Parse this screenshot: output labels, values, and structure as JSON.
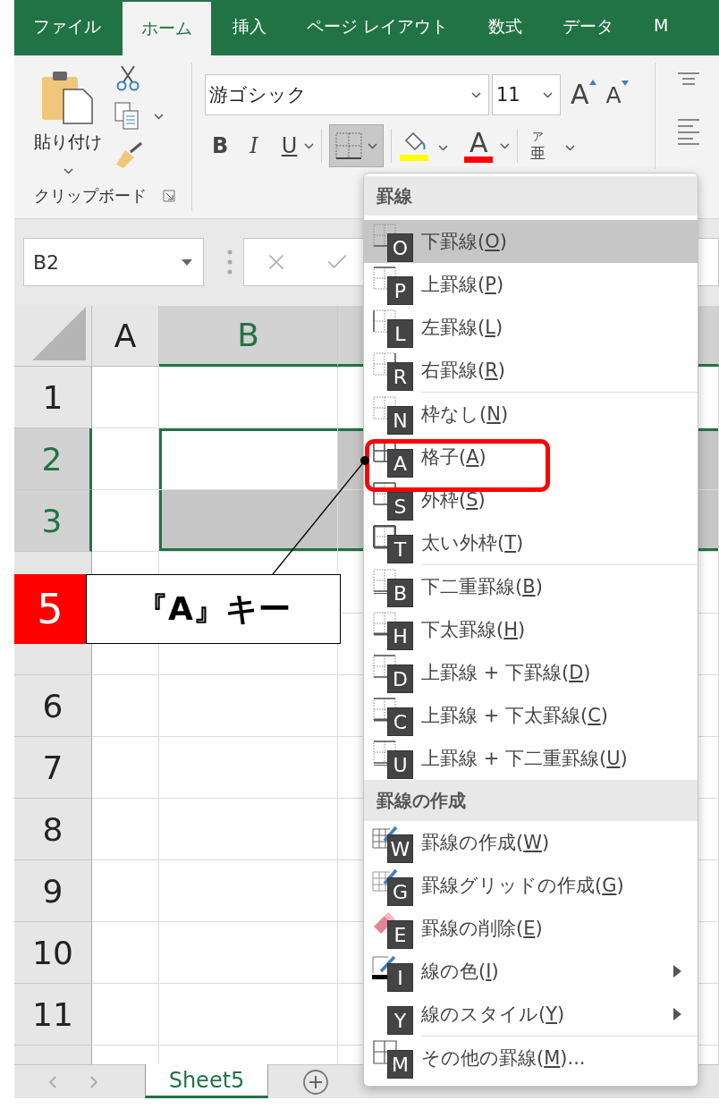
{
  "tabs": [
    {
      "label": "ファイル",
      "selected": false
    },
    {
      "label": "ホーム",
      "selected": true
    },
    {
      "label": "挿入",
      "selected": false
    },
    {
      "label": "ページ レイアウト",
      "selected": false
    },
    {
      "label": "数式",
      "selected": false
    },
    {
      "label": "データ",
      "selected": false
    },
    {
      "label": "M",
      "selected": false
    }
  ],
  "clipboard": {
    "paste_label": "貼り付け",
    "group_label": "クリップボード"
  },
  "font": {
    "name": "游ゴシック",
    "size": "11",
    "grow_glyph": "A",
    "shrink_glyph": "A",
    "bold": "B",
    "italic": "I",
    "underline": "U",
    "borders_pressed": true,
    "font_color_glyph": "A",
    "phonetic_top": "ア",
    "phonetic_bottom": "亜"
  },
  "formula_bar": {
    "name_box": "B2"
  },
  "columns": [
    {
      "label": "A",
      "selected": false
    },
    {
      "label": "B",
      "selected": true
    },
    {
      "selected": true
    }
  ],
  "rows": [
    {
      "number": "1",
      "selected": false,
      "cells": [
        {
          "shaded": false
        },
        {
          "shaded": false
        },
        {
          "shaded": false
        }
      ]
    },
    {
      "number": "2",
      "selected": true,
      "cells": [
        {
          "shaded": false
        },
        {
          "shaded": false
        },
        {
          "shaded": true
        }
      ]
    },
    {
      "number": "3",
      "selected": true,
      "cells": [
        {
          "shaded": false
        },
        {
          "shaded": true
        },
        {
          "shaded": true
        }
      ]
    },
    {
      "selected": false,
      "cells": [
        {
          "shaded": false
        },
        {
          "shaded": false
        },
        {
          "shaded": false
        }
      ]
    },
    {
      "selected": false,
      "cells": [
        {
          "shaded": false
        },
        {
          "shaded": false
        },
        {
          "shaded": false
        }
      ]
    },
    {
      "number": "6",
      "selected": false,
      "cells": [
        {
          "shaded": false
        },
        {
          "shaded": false
        },
        {
          "shaded": false
        }
      ]
    },
    {
      "number": "7",
      "selected": false,
      "cells": [
        {
          "shaded": false
        },
        {
          "shaded": false
        },
        {
          "shaded": false
        }
      ]
    },
    {
      "number": "8",
      "selected": false,
      "cells": [
        {
          "shaded": false
        },
        {
          "shaded": false
        },
        {
          "shaded": false
        }
      ]
    },
    {
      "number": "9",
      "selected": false,
      "cells": [
        {
          "shaded": false
        },
        {
          "shaded": false
        },
        {
          "shaded": false
        }
      ]
    },
    {
      "number": "10",
      "selected": false,
      "cells": [
        {
          "shaded": false
        },
        {
          "shaded": false
        },
        {
          "shaded": false
        }
      ]
    },
    {
      "number": "11",
      "selected": false,
      "cells": [
        {
          "shaded": false
        },
        {
          "shaded": false
        },
        {
          "shaded": false
        }
      ]
    }
  ],
  "sheet_tabs": [
    {
      "label": "Sheet5",
      "selected": true
    }
  ],
  "border_menu": {
    "sections": [
      {
        "title": "罫線",
        "groups": [
          [
            {
              "text": "下罫線(",
              "access_key": "O",
              "text_after": ")",
              "keytip": "O",
              "selected": true,
              "submenu": false,
              "emphasized": false
            },
            {
              "text": "上罫線(",
              "access_key": "P",
              "text_after": ")",
              "keytip": "P",
              "selected": false,
              "submenu": false,
              "emphasized": false
            },
            {
              "text": "左罫線(",
              "access_key": "L",
              "text_after": ")",
              "keytip": "L",
              "selected": false,
              "submenu": false,
              "emphasized": false
            },
            {
              "text": "右罫線(",
              "access_key": "R",
              "text_after": ")",
              "keytip": "R",
              "selected": false,
              "submenu": false,
              "emphasized": false
            }
          ],
          [
            {
              "text": "枠なし(",
              "access_key": "N",
              "text_after": ")",
              "keytip": "N",
              "selected": false,
              "submenu": false,
              "emphasized": false
            },
            {
              "text": "格子(",
              "access_key": "A",
              "text_after": ")",
              "keytip": "A",
              "selected": false,
              "submenu": false,
              "emphasized": true
            },
            {
              "text": "外枠(",
              "access_key": "S",
              "text_after": ")",
              "keytip": "S",
              "selected": false,
              "submenu": false,
              "emphasized": false
            },
            {
              "text": "太い外枠(",
              "access_key": "T",
              "text_after": ")",
              "keytip": "T",
              "selected": false,
              "submenu": false,
              "emphasized": false
            }
          ],
          [
            {
              "text": "下二重罫線(",
              "access_key": "B",
              "text_after": ")",
              "keytip": "B",
              "selected": false,
              "submenu": false,
              "emphasized": false
            },
            {
              "text": "下太罫線(",
              "access_key": "H",
              "text_after": ")",
              "keytip": "H",
              "selected": false,
              "submenu": false,
              "emphasized": false
            },
            {
              "text": "上罫線 + 下罫線(",
              "access_key": "D",
              "text_after": ")",
              "keytip": "D",
              "selected": false,
              "submenu": false,
              "emphasized": false
            },
            {
              "text": "上罫線 + 下太罫線(",
              "access_key": "C",
              "text_after": ")",
              "keytip": "C",
              "selected": false,
              "submenu": false,
              "emphasized": false
            },
            {
              "text": "上罫線 + 下二重罫線(",
              "access_key": "U",
              "text_after": ")",
              "keytip": "U",
              "selected": false,
              "submenu": false,
              "emphasized": false
            }
          ]
        ]
      },
      {
        "title": "罫線の作成",
        "groups": [
          [
            {
              "text": "罫線の作成(",
              "access_key": "W",
              "text_after": ")",
              "keytip": "W",
              "selected": false,
              "submenu": false,
              "emphasized": false
            },
            {
              "text": "罫線グリッドの作成(",
              "access_key": "G",
              "text_after": ")",
              "keytip": "G",
              "selected": false,
              "submenu": false,
              "emphasized": false
            },
            {
              "text": "罫線の削除(",
              "access_key": "E",
              "text_after": ")",
              "keytip": "E",
              "selected": false,
              "submenu": false,
              "emphasized": false
            },
            {
              "text": "線の色(",
              "access_key": "I",
              "text_after": ")",
              "keytip": "I",
              "selected": false,
              "submenu": true,
              "emphasized": false
            },
            {
              "text": "線のスタイル(",
              "access_key": "Y",
              "text_after": ")",
              "keytip": "Y",
              "selected": false,
              "submenu": true,
              "emphasized": false
            }
          ],
          [
            {
              "text": "その他の罫線(",
              "access_key": "M",
              "text_after": ")...",
              "keytip": "M",
              "selected": false,
              "submenu": false,
              "emphasized": false
            }
          ]
        ]
      }
    ]
  },
  "callout": {
    "step": "5",
    "text": "『A』キー"
  }
}
